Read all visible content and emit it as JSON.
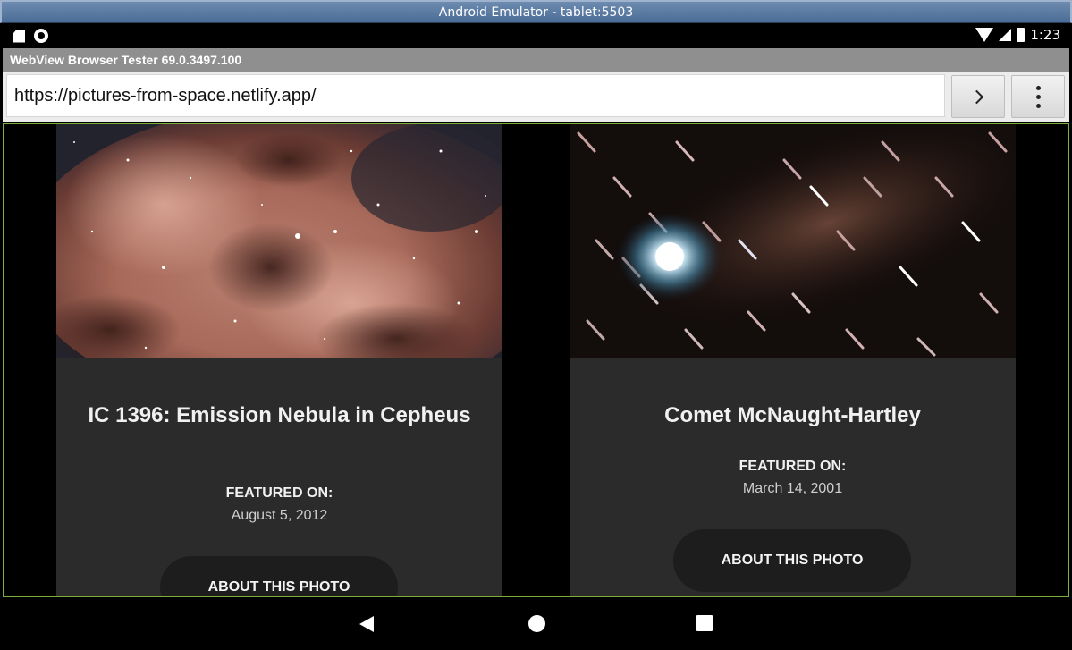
{
  "window": {
    "title": "Android Emulator - tablet:5503"
  },
  "status": {
    "time": "1:23",
    "icons": [
      "sd-card-icon",
      "circle-icon",
      "wifi-icon",
      "signal-icon",
      "battery-icon"
    ]
  },
  "app": {
    "title": "WebView Browser Tester 69.0.3497.100"
  },
  "browser": {
    "url": "https://pictures-from-space.netlify.app/",
    "go_icon": "chevron-right-icon",
    "menu_icon": "overflow-menu-icon"
  },
  "cards": [
    {
      "title": "IC 1396: Emission Nebula in Cepheus",
      "featured_label": "FEATURED ON:",
      "featured_date": "August 5, 2012",
      "button": "ABOUT THIS PHOTO"
    },
    {
      "title": "Comet McNaught-Hartley",
      "featured_label": "FEATURED ON:",
      "featured_date": "March 14, 2001",
      "button": "ABOUT THIS PHOTO"
    }
  ],
  "navbar": {
    "icons": [
      "back-icon",
      "home-icon",
      "recents-icon"
    ]
  },
  "colors": {
    "card_bg": "#2b2b2b",
    "button_bg": "#1d1d1d",
    "webview_border": "#7bb03a",
    "appbar_bg": "#8f8f8f"
  }
}
